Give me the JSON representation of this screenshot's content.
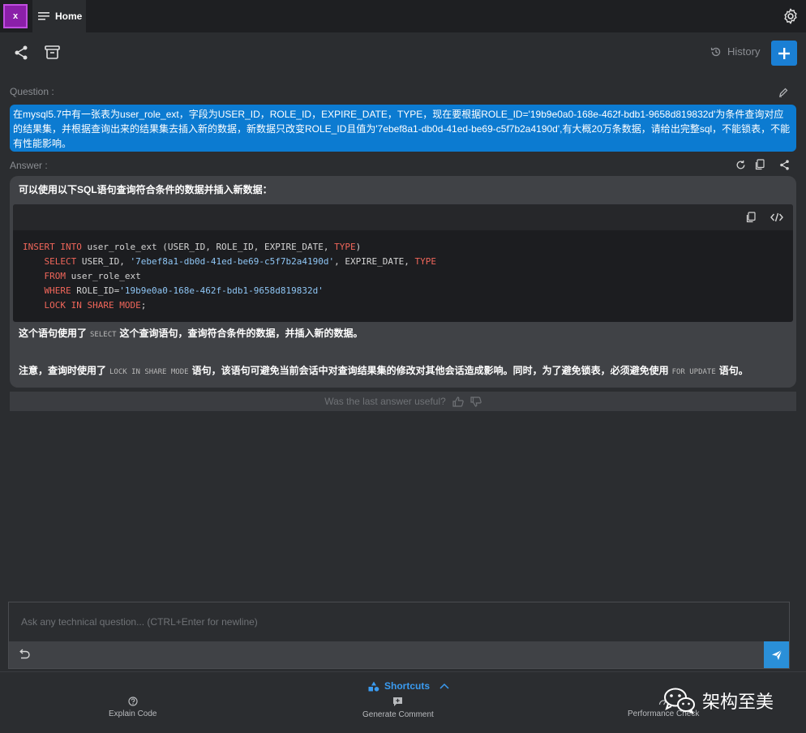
{
  "titlebar": {
    "close_tab": "x",
    "home_tab": "Home"
  },
  "toolbar": {
    "history_label": "History"
  },
  "question": {
    "label": "Question :",
    "text": "在mysql5.7中有一张表为user_role_ext，字段为USER_ID，ROLE_ID，EXPIRE_DATE，TYPE，现在要根据ROLE_ID='19b9e0a0-168e-462f-bdb1-9658d819832d'为条件查询对应的结果集，并根据查询出来的结果集去插入新的数据，新数据只改变ROLE_ID且值为'7ebef8a1-db0d-41ed-be69-c5f7b2a4190d',有大概20万条数据，请给出完整sql，不能锁表，不能有性能影响。"
  },
  "answer": {
    "label": "Answer :",
    "intro": "可以使用以下SQL语句查询符合条件的数据并插入新数据：",
    "code": {
      "l1_kw1": "INSERT",
      "l1_kw2": "INTO",
      "l1_rest": " user_role_ext (USER_ID, ROLE_ID, EXPIRE_DATE, ",
      "l1_type": "TYPE",
      "l1_end": ")",
      "l2_kw": "SELECT",
      "l2_a": " USER_ID, ",
      "l2_str": "'7ebef8a1-db0d-41ed-be69-c5f7b2a4190d'",
      "l2_b": ", EXPIRE_DATE, ",
      "l2_type": "TYPE",
      "l3_kw": "FROM",
      "l3_rest": " user_role_ext",
      "l4_kw": "WHERE",
      "l4_a": " ROLE_ID=",
      "l4_str": "'19b9e0a0-168e-462f-bdb1-9658d819832d'",
      "l5_kw1": "LOCK",
      "l5_kw2": "IN",
      "l5_kw3": "SHARE",
      "l5_kw4": "MODE",
      "l5_end": ";"
    },
    "para1_a": "这个语句使用了",
    "para1_code": "SELECT",
    "para1_b": "这个查询语句，查询符合条件的数据，并插入新的数据。",
    "para2_a": "注意，查询时使用了",
    "para2_code": "LOCK IN SHARE MODE",
    "para2_b": "语句，该语句可避免当前会话中对查询结果集的修改对其他会话造成影响。同时，为了避免锁表，必须避免使用",
    "para2_code2": "FOR UPDATE",
    "para2_c": "语句。"
  },
  "feedback": {
    "text": "Was the last answer useful?"
  },
  "input": {
    "placeholder": "Ask any technical question... (CTRL+Enter for newline)",
    "value": ""
  },
  "shortcuts": {
    "label": "Shortcuts",
    "items": [
      {
        "label": "Explain Code"
      },
      {
        "label": "Generate Comment"
      },
      {
        "label": "Performance Check"
      }
    ]
  },
  "watermark": {
    "text": "架构至美"
  },
  "colors": {
    "accent": "#1a7fd4",
    "question_bg": "#0c7bd1",
    "keyword": "#f0665a",
    "string": "#8fc6f5"
  }
}
